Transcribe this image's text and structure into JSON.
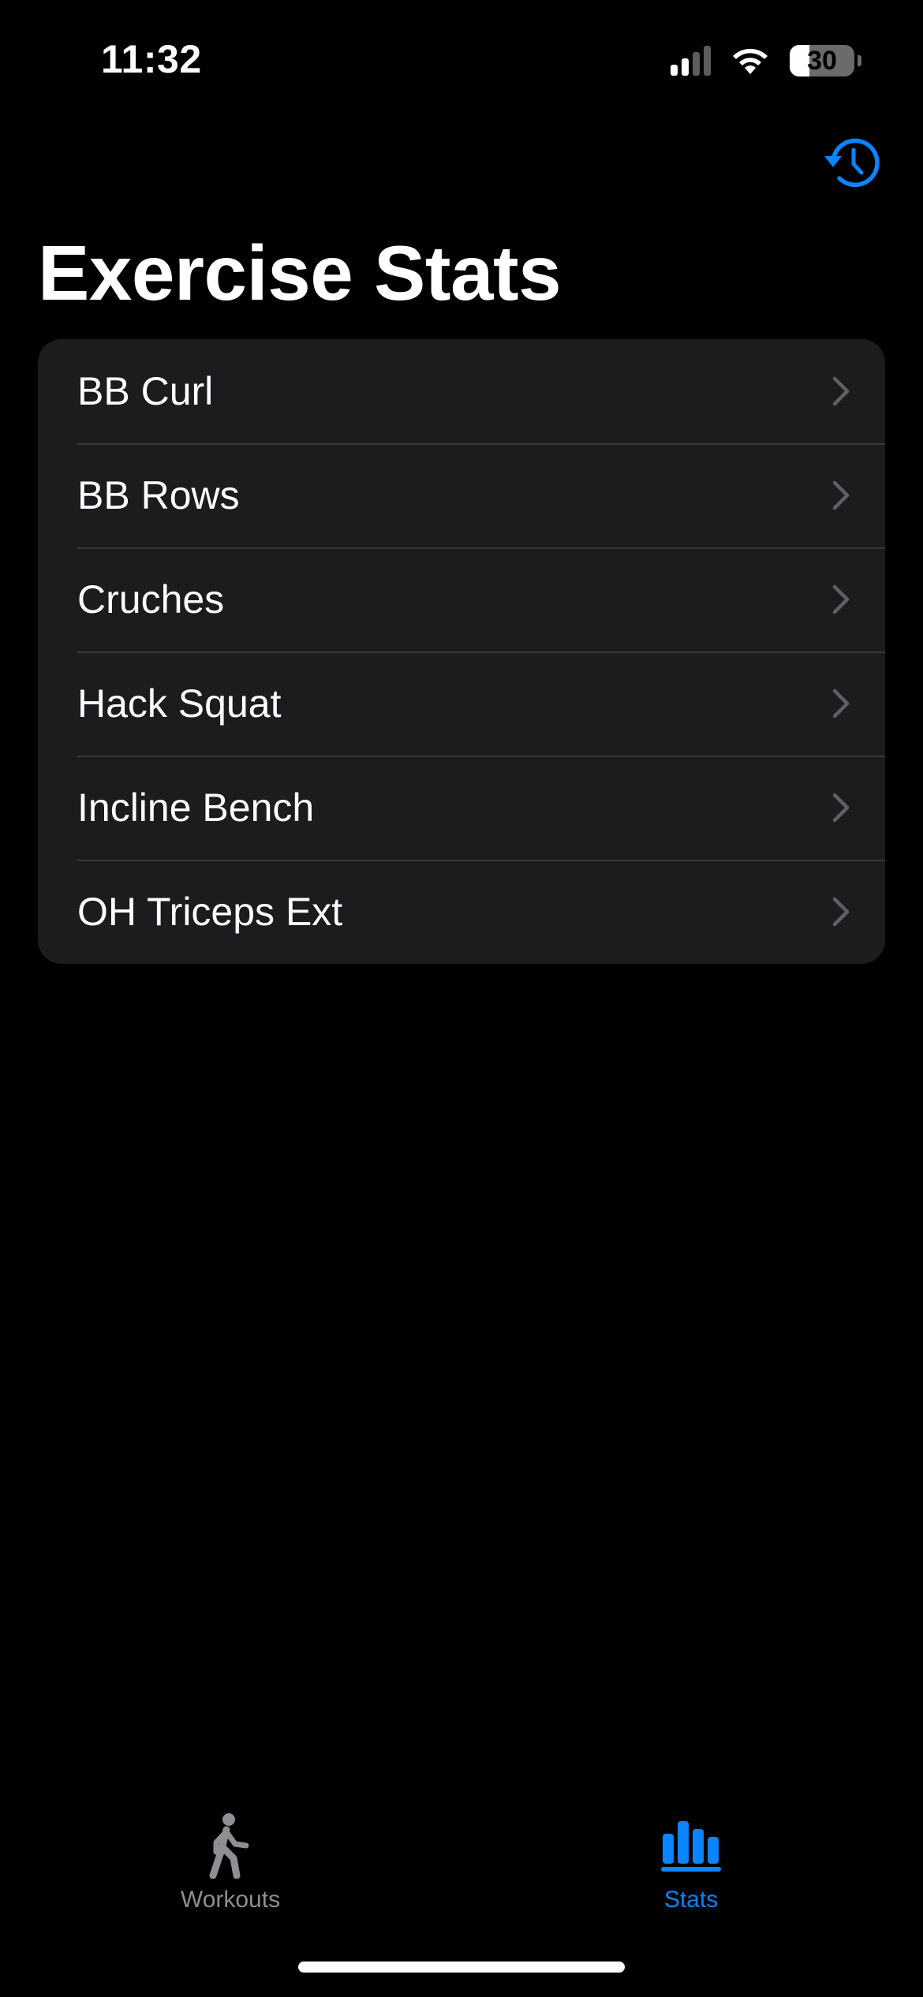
{
  "status_bar": {
    "time": "11:32",
    "battery_percent": "30",
    "battery_level": 0.3,
    "signal_bars_active": 2,
    "signal_bars_total": 4
  },
  "nav": {
    "history_icon": "clock-arrow-circlepath-icon"
  },
  "page": {
    "title": "Exercise Stats"
  },
  "exercises": [
    {
      "label": "BB Curl"
    },
    {
      "label": "BB Rows"
    },
    {
      "label": "Cruches"
    },
    {
      "label": "Hack Squat"
    },
    {
      "label": "Incline Bench"
    },
    {
      "label": "OH Triceps Ext"
    }
  ],
  "tab_bar": {
    "tabs": [
      {
        "label": "Workouts",
        "icon": "figure-walk-icon",
        "selected": false
      },
      {
        "label": "Stats",
        "icon": "chart-bar-icon",
        "selected": true
      }
    ]
  },
  "colors": {
    "accent": "#0a84ff",
    "background": "#000000",
    "card": "#1c1c1e",
    "separator": "#38383a",
    "inactive": "#8e8e93"
  }
}
